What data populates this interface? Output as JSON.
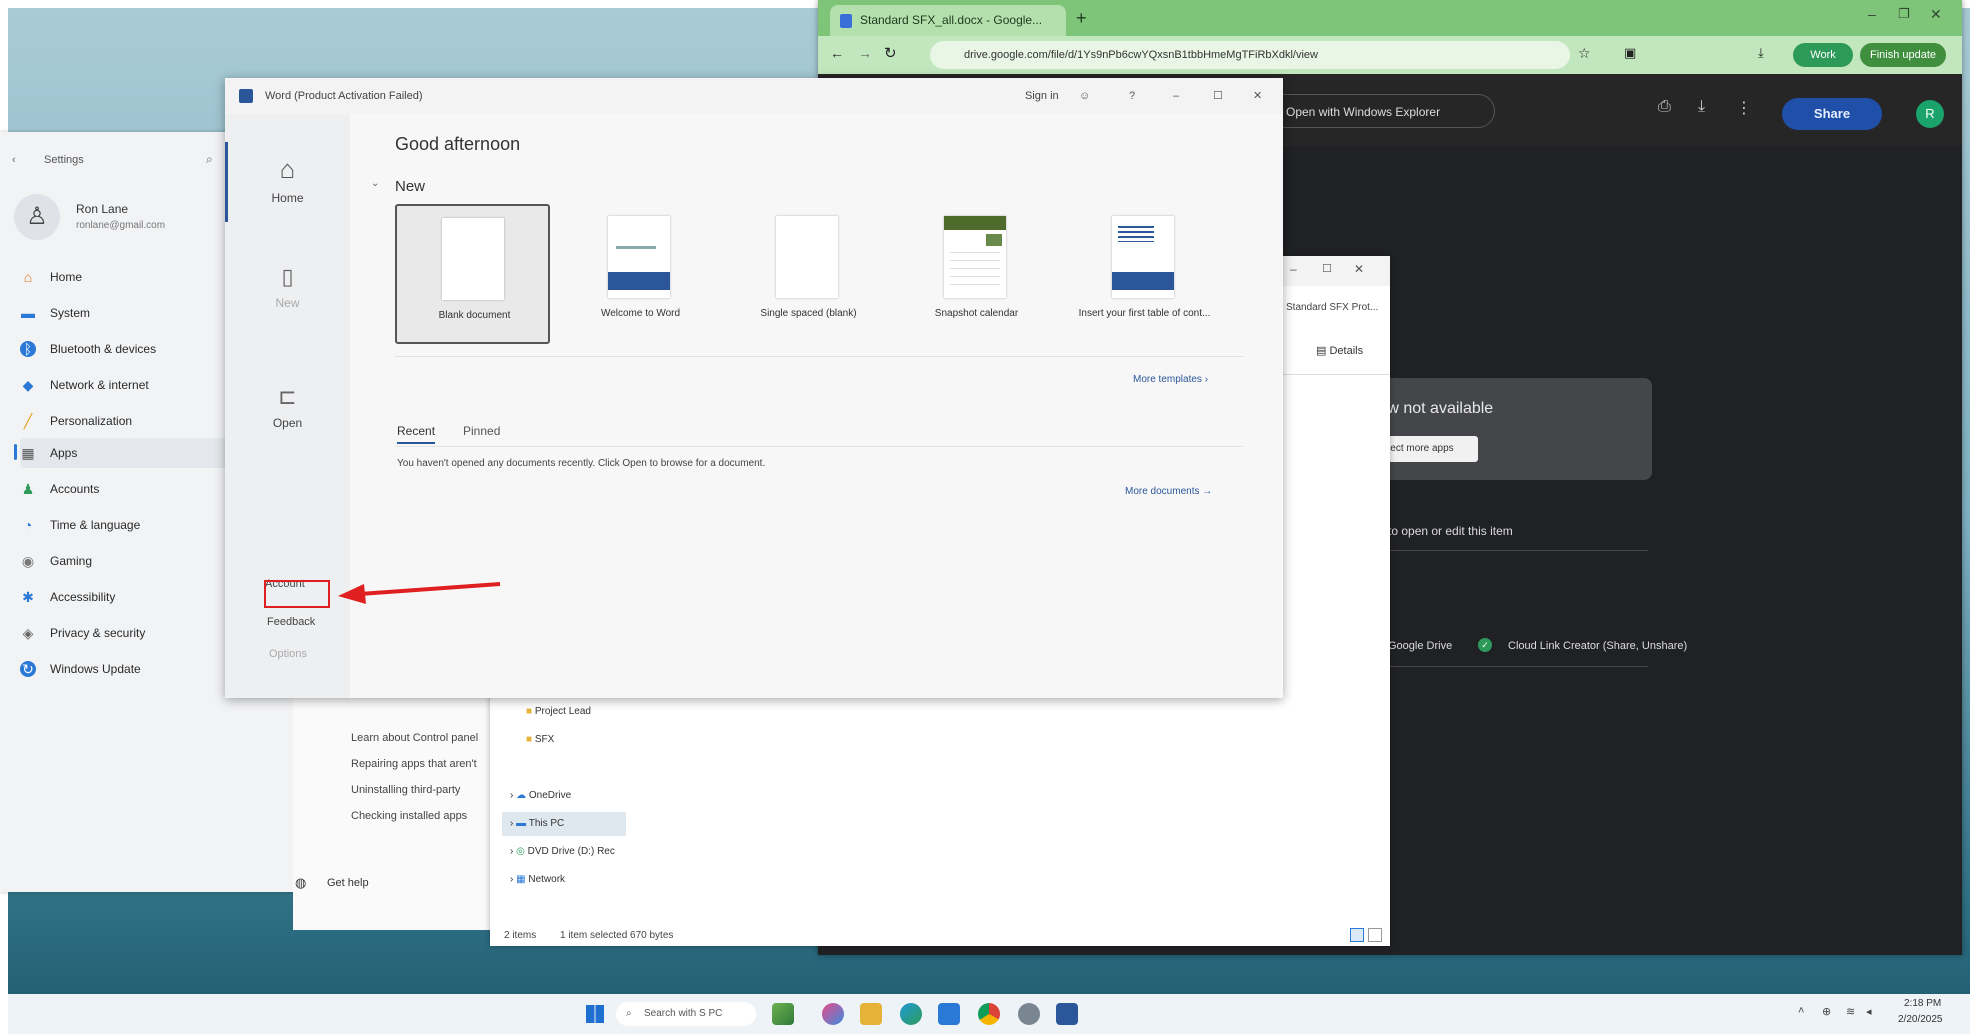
{
  "chrome": {
    "tab_title": "Standard SFX_all.docx - Google...",
    "address": "drive.google.com/file/d/1Ys9nPb6cwYQxsnB1tbbHmeMgTFiRbXdkl/view",
    "pill_work": "Work",
    "pill_finish_update": "Finish update",
    "open_with": "Open with Windows Explorer",
    "share": "Share",
    "avatar_letter": "R",
    "preview_unavailable": "Preview not available",
    "connect_more_apps": "Connect more apps",
    "open_or_edit": "to open or edit this item",
    "google_drive": "Google Drive",
    "cloud_link": "Cloud Link Creator (Share, Unshare)"
  },
  "settings": {
    "title": "Settings",
    "user_name": "Ron Lane",
    "user_email": "ronlane@gmail.com",
    "items": [
      {
        "icon": "⌂",
        "label": "Home"
      },
      {
        "icon": "▬",
        "label": "System"
      },
      {
        "icon": "ᛒ",
        "label": "Bluetooth & devices"
      },
      {
        "icon": "◆",
        "label": "Network & internet"
      },
      {
        "icon": "╱",
        "label": "Personalization"
      },
      {
        "icon": "▦",
        "label": "Apps"
      },
      {
        "icon": "♟",
        "label": "Accounts"
      },
      {
        "icon": "◔",
        "label": "Time & language"
      },
      {
        "icon": "◉",
        "label": "Gaming"
      },
      {
        "icon": "✱",
        "label": "Accessibility"
      },
      {
        "icon": "◈",
        "label": "Privacy & security"
      },
      {
        "icon": "↻",
        "label": "Windows Update"
      }
    ],
    "get_help": "Get help"
  },
  "control_panel": {
    "links": [
      "Learn about Control panel",
      "Repairing apps that aren't",
      "Uninstalling third-party",
      "Checking installed apps"
    ]
  },
  "explorer": {
    "tab_label": "Standard SFX Prot...",
    "details": "Details",
    "tree": [
      "Project Lead",
      "SFX",
      "OneDrive",
      "This PC",
      "DVD Drive (D:) Rec",
      "Network"
    ],
    "status_items": "2 items",
    "status_selected": "1 item selected  670 bytes"
  },
  "word": {
    "title": "Word (Product Activation Failed)",
    "sign_in": "Sign in",
    "greeting": "Good afternoon",
    "new_header": "New",
    "nav": {
      "home": "Home",
      "new": "New",
      "open": "Open",
      "account": "Account",
      "feedback": "Feedback",
      "options": "Options"
    },
    "templates": [
      "Blank document",
      "Welcome to Word",
      "Single spaced (blank)",
      "Snapshot calendar",
      "Insert your first table of cont..."
    ],
    "more_templates": "More templates",
    "tab_recent": "Recent",
    "tab_pinned": "Pinned",
    "recent_empty": "You haven't opened any documents recently. Click Open to browse for a document.",
    "more_documents": "More documents"
  },
  "taskbar": {
    "search": "Search with S PC",
    "time": "2:18 PM",
    "date": "2/20/2025"
  },
  "colors": {
    "annotation_red": "#e02020",
    "word_blue": "#2b579a"
  }
}
